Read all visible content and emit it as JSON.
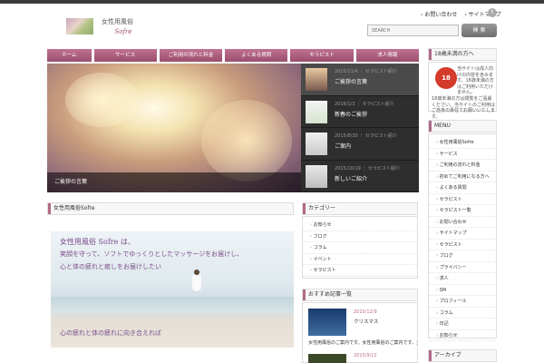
{
  "header": {
    "logo_title": "女性用風俗",
    "logo_sub": "Sofre",
    "links": [
      "お問い合わせ",
      "サイトマップ"
    ],
    "search_placeholder": "SEARCH",
    "search_button": "検 索"
  },
  "nav": {
    "items": [
      "ホーム",
      "サービス",
      "ご利用の流れと料金",
      "よくある質問",
      "セラピスト",
      "求人情報"
    ]
  },
  "slider": {
    "caption": "ご挨拶の言葉"
  },
  "features": [
    {
      "date": "2015/11/4",
      "category": "セラピスト紹介",
      "title": "ご挨拶の言葉"
    },
    {
      "date": "2016/1/3",
      "category": "セラピスト紹介",
      "title": "新春のご挨拶"
    },
    {
      "date": "2015/8/30",
      "category": "セラピスト紹介",
      "title": "ご案内"
    },
    {
      "date": "2015/10/19",
      "category": "セラピスト紹介",
      "title": "新しいご紹介"
    }
  ],
  "main": {
    "heading": "女性用風俗Sofre",
    "image_line1": "女性用風俗  Sofre  は、",
    "image_line2": "笑顔を守って、ソフトでゆっくりとしたマッサージをお届けし、",
    "image_line3": "心と体の疲れと癒しをお届けしたい",
    "image_line4": "心の疲れと体の疲れに向き合えれば"
  },
  "categories_box": {
    "heading": "カテゴリー",
    "items": [
      "お知らせ",
      "ブログ",
      "コラム",
      "イベント",
      "セラピスト"
    ]
  },
  "recommend_box": {
    "heading": "おすすめ記事一覧",
    "items": [
      {
        "date": "2015/12/9",
        "title": "クリスマス"
      },
      {
        "date": "2015/9/12",
        "title": ""
      }
    ],
    "excerpt": "女性用風俗のご案内です。女性用風俗のご案内です。女性用風俗のご案内です。女性用風俗 ..."
  },
  "r18_box": {
    "heading": "18歳未満の方へ",
    "icon": "18",
    "text1": "当サイトは成人向けの内容を含みます。18歳未満の方はご利用いただけません。",
    "text2": "18歳未満の方は閲覧をご遠慮ください。当サイトのご利用はご自身の責任でお願いいたします。"
  },
  "menu_box": {
    "heading": "MENU",
    "items": [
      "女性用風俗Sofre",
      "サービス",
      "ご利用の流れと料金",
      "初めてご利用になる方へ",
      "よくある質問",
      "セラピスト",
      "セラピスト一覧",
      "お問い合わせ",
      "サイトマップ",
      "セラピスト",
      "ブログ",
      "プライバシー",
      "求人",
      "SM",
      "プロフィール",
      "コラム",
      "日記",
      "お知らせ"
    ]
  },
  "bottom_box": {
    "heading": "アーカイブ"
  }
}
